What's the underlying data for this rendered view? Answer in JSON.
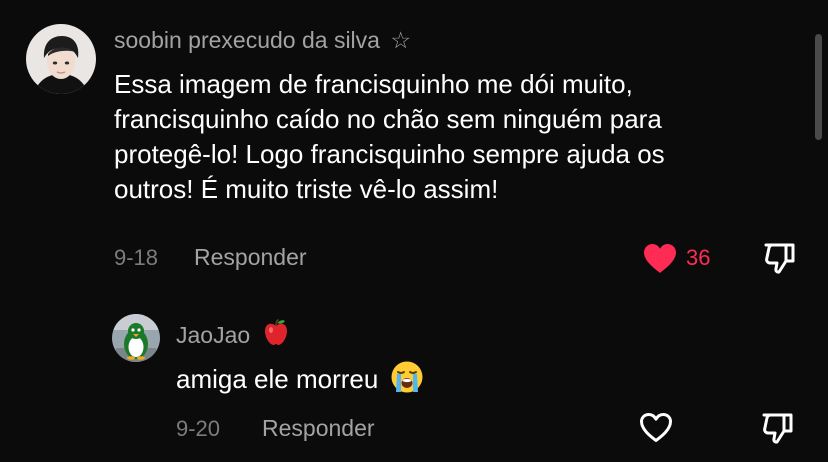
{
  "comments": [
    {
      "username": "soobin prexecudo da silva",
      "username_badge": "☆",
      "text_lines": [
        "Essa imagem de francisquinho me dói muito,",
        "francisquinho caído no chão sem ninguém para",
        "protegê-lo! Logo francisquinho sempre ajuda os",
        "outros! É muito triste vê-lo assim!"
      ],
      "date": "9-18",
      "reply_label": "Responder",
      "like_count": "36",
      "liked": true,
      "avatar_icon": "person-avatar-icon",
      "like_icon": "heart-filled-icon",
      "dislike_icon": "thumbs-down-icon"
    },
    {
      "username": "JaoJao",
      "username_badge_icon": "red-apple-icon",
      "text": "amiga ele morreu",
      "text_emoji_icon": "loudly-crying-face-icon",
      "date": "9-20",
      "reply_label": "Responder",
      "liked": false,
      "avatar_icon": "penguin-avatar-icon",
      "like_icon": "heart-outline-icon",
      "dislike_icon": "thumbs-down-icon"
    }
  ],
  "colors": {
    "background": "#0b0b0b",
    "username": "#a3a3a3",
    "meta": "#7c7c7c",
    "like_active": "#fe2c55"
  }
}
